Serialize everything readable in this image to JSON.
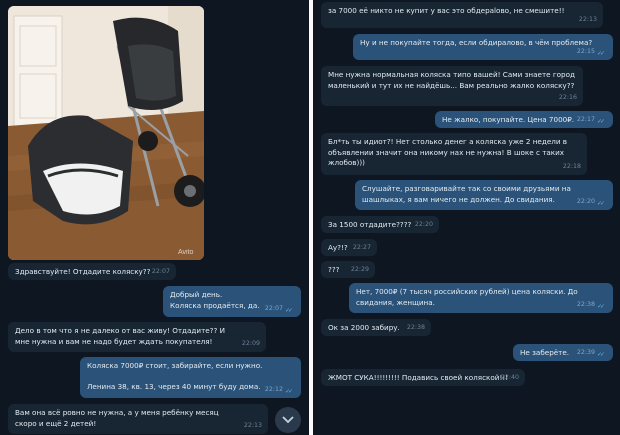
{
  "left_chat": {
    "photo_watermark": "Avito",
    "messages": [
      {
        "text": "Здравствуйте! Отдадите коляску??",
        "time": "22:07"
      },
      {
        "text": "Добрый день.\nКоляска продаётся, да.",
        "time": "22:07"
      },
      {
        "text": "Дело в том что я не далеко от вас живу! Отдадите?? И мне нужна и вам не надо будет ждать покупателя!",
        "time": "22:09"
      },
      {
        "text": "Коляска 7000₽ стоит, забирайте, если нужно.\n\nЛенина 38, кв. 13, через 40 минут буду дома.",
        "time": "22:12"
      },
      {
        "text": "Вам она всё ровно не нужна, а у меня ребёнку месяц скоро и ещё 2 детей!",
        "time": "22:13"
      }
    ]
  },
  "right_chat": {
    "messages": [
      {
        "text": "за 7000 её никто не купит у вас это обдерalово, не смешите!!",
        "time": "22:13"
      },
      {
        "text": "Ну и не покупайте тогда, если обдиралово, в чём проблема?",
        "time": "22:15"
      },
      {
        "text": "Мне нужна нормальная коляска типо вашей! Сами знаете город маленький и тут их не найдёшь... Вам реально жалко коляску??",
        "time": "22:16"
      },
      {
        "text": "Не жалко, покупайте. Цена 7000₽.",
        "time": "22:17"
      },
      {
        "text": "Бл*ть ты идиот?! Нет столько денег а коляска уже 2 недели в объявлении значит она никому нах не нужна! В шоке с таких жлобов)))",
        "time": "22:18"
      },
      {
        "text": "Слушайте, разговаривайте так со своими друзьями на шашлыках, я вам ничего не должен. До свидания.",
        "time": "22:20"
      },
      {
        "text": "За 1500 отдадите????",
        "time": "22:20"
      },
      {
        "text": "Ау?!?",
        "time": "22:27"
      },
      {
        "text": "???",
        "time": "22:29"
      },
      {
        "text": "Нет, 7000₽ (7 тысяч российских рублей) цена коляски. До свидания, женщина.",
        "time": "22:38"
      },
      {
        "text": "Ок за 2000 забиру.",
        "time": "22:38"
      },
      {
        "text": "Не заберёте.",
        "time": "22:39"
      },
      {
        "text": "ЖМОТ СУКА!!!!!!!!! Подавись своей коляской!!!",
        "time": "22:40"
      }
    ]
  },
  "colors": {
    "background": "#0e1621",
    "incoming": "#182533",
    "outgoing": "#2b5278",
    "tick": "#5fb4f0"
  }
}
